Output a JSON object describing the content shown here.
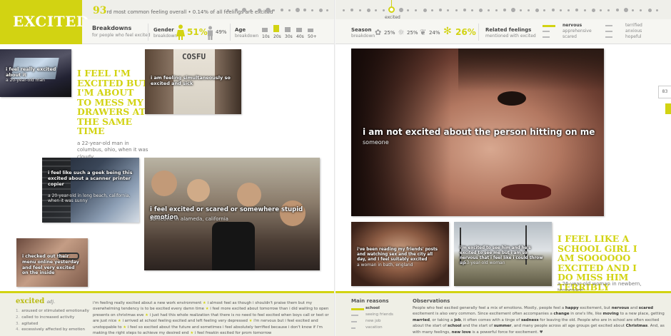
{
  "title": "EXCITED",
  "rank": {
    "number": "93",
    "text": "rd most common feeling overall",
    "share": "• 0.14% of all feelings are excited"
  },
  "timeline": {
    "selected_label": "excited"
  },
  "breakdowns": {
    "title": "Breakdowns",
    "subtitle": "for people who feel excited"
  },
  "gender": {
    "title": "Gender",
    "sub": "breakdown",
    "female_pct": "51%",
    "male_pct": "49%"
  },
  "age": {
    "title": "Age",
    "sub": "breakdown",
    "groups": [
      "10s",
      "20s",
      "30s",
      "40s",
      "50+"
    ],
    "levels": [
      0.35,
      1.0,
      0.45,
      0.25,
      0.15
    ]
  },
  "season": {
    "title": "Season",
    "sub": "breakdown",
    "values": [
      "25%",
      "25%",
      "24%",
      "26%"
    ],
    "icons": [
      "flower-icon",
      "sun-icon",
      "leaf-icon",
      "snowflake-icon"
    ]
  },
  "related": {
    "title": "Related feelings",
    "sub": "mentioned with excited",
    "col1": [
      "nervous",
      "apprehensive",
      "scared"
    ],
    "col2": [
      "terrified",
      "anxious",
      "hopeful"
    ]
  },
  "left_photos": [
    {
      "text": "i feel really excited about it",
      "attr": "a 20-year-old man"
    },
    {
      "text": "i am feeling simultaneously so excited and sick",
      "attr": ""
    },
    {
      "text": "i feel like such a geek being this excited about a scanner printer copier",
      "attr": "a 20-year-old in long beach, california, when it was sunny"
    },
    {
      "text": "i feel excited or scared or somewhere stupid emotion",
      "attr": "someone in alameda, california"
    },
    {
      "text": "i checked out their menu online yesterday and feel very excited on the inside",
      "attr": ""
    }
  ],
  "headline1": {
    "text": "I FEEL I'M EXCITED BUT I'M ABOUT TO MESS MY DRAWERS AT THE SAME TIME",
    "byline": "a 22-year-old man in columbus, ohio, when it was cloudy"
  },
  "shirt_text": "COSFU",
  "right_main": {
    "text": "i am not excited about the person hitting on me",
    "attr": "someone"
  },
  "right_photos": [
    {
      "text": "i've been reading my friends' posts and watching sex and the city all day, and I feel suitably excited",
      "attr": "a woman in bath, england"
    },
    {
      "text": "i'm excited to see him and he's excited to see me but i am so nervous that i feel like i could throw up",
      "attr": "a 53-year-old woman"
    }
  ],
  "headline2": {
    "text": "I FEEL LIKE A SCHOOL GIRL I AM SOOOOOO EXCITED AND I DO MISS HIM TERRIBLY",
    "byline": "a 26-year-old woman in newbern, tennessee"
  },
  "page_number": "83",
  "definition": {
    "word": "excited",
    "pos": "adj.",
    "senses": [
      "aroused or stimulated emotionally",
      "called to increased activity",
      "agitated",
      "excessively affected by emotion"
    ]
  },
  "feelings_text": [
    "i'm feeling really excited about a new work environment",
    "i almost feel as though i shouldn't praise them but my overwhelming tendency is to be excited every damn time",
    "i feel more excited about tomorrow than i did waiting to open presents on christmas eve",
    "i just had this whole realization that there is no need to feel excited when boys call or text or are just nice",
    "i arrived at school feeling excited and left feeling very depressed",
    "i'm nervous but i feel excited and unstoppable to",
    "i feel so excited about the future and sometimes i feel absolutely terrified because i don't know if i'm making the right steps to achieve my desired end",
    "i feel freakin excited for prom tomorrow"
  ],
  "main_reasons": {
    "title": "Main reasons",
    "items": [
      "school",
      "seeing friends",
      "new job",
      "vacation"
    ],
    "weights": [
      1.0,
      0.55,
      0.45,
      0.35
    ]
  },
  "observations": {
    "title": "Observations",
    "parts": [
      {
        "t": "People who feel excited generally feel a mix of emotions. Mostly, people feel a ",
        "b": false
      },
      {
        "t": "happy",
        "b": true
      },
      {
        "t": " excitement, but ",
        "b": false
      },
      {
        "t": "nervous",
        "b": true
      },
      {
        "t": " and ",
        "b": false
      },
      {
        "t": "scared",
        "b": true
      },
      {
        "t": " excitement is also very common. Since excitement often accompanies a ",
        "b": false
      },
      {
        "t": "change",
        "b": true
      },
      {
        "t": " in one's life, like ",
        "b": false
      },
      {
        "t": "moving",
        "b": true
      },
      {
        "t": " to a new place, getting ",
        "b": false
      },
      {
        "t": "married",
        "b": true
      },
      {
        "t": ", or taking a ",
        "b": false
      },
      {
        "t": "job",
        "b": true
      },
      {
        "t": ", it often comes with a tinge of ",
        "b": false
      },
      {
        "t": "sadness",
        "b": true
      },
      {
        "t": " for leaving the old. People who are in school are often excited about the start of ",
        "b": false
      },
      {
        "t": "school",
        "b": true
      },
      {
        "t": " and the start of ",
        "b": false
      },
      {
        "t": "summer",
        "b": true
      },
      {
        "t": ", and many people across all age groups get excited about ",
        "b": false
      },
      {
        "t": "Christmas",
        "b": true
      },
      {
        "t": ". And, as with many feelings, ",
        "b": false
      },
      {
        "t": "new love",
        "b": true
      },
      {
        "t": " is a powerful force for excitement. ♥",
        "b": false
      }
    ]
  },
  "colors": {
    "accent": "#d2d312",
    "bar": "#efefe6"
  }
}
